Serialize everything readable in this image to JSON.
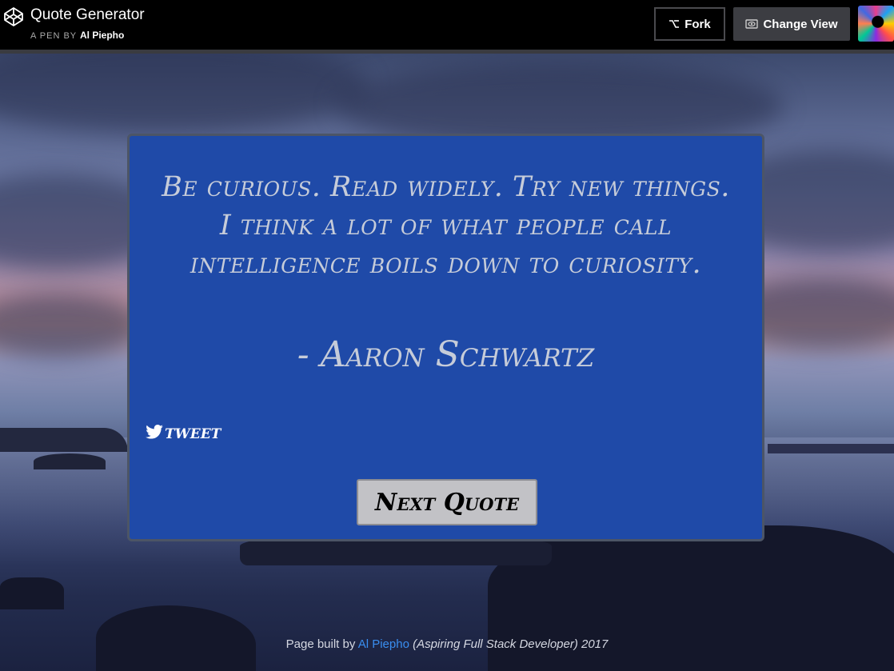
{
  "header": {
    "title": "Quote Generator",
    "byline_prefix": "A PEN BY",
    "author": "Al Piepho",
    "fork_label": "Fork",
    "change_view_label": "Change View"
  },
  "quote": {
    "text": "Be curious. Read widely. Try new things. I think a lot of what people call intelligence boils down to curiosity.",
    "author": "- Aaron Schwartz"
  },
  "actions": {
    "tweet_label": "tweet",
    "next_label": "Next Quote"
  },
  "footer": {
    "prefix": "Page built by",
    "author_link": "Al Piepho",
    "suffix": "(Aspiring Full Stack Developer) 2017"
  },
  "colors": {
    "card_bg": "#1f4aa8",
    "quote_text": "#c6ccd9",
    "link": "#3a8ef0",
    "topbar": "#000000"
  },
  "icons": {
    "logo": "codepen-logo-icon",
    "fork": "fork-icon",
    "view": "eye-icon",
    "tweet": "twitter-bird-icon"
  }
}
